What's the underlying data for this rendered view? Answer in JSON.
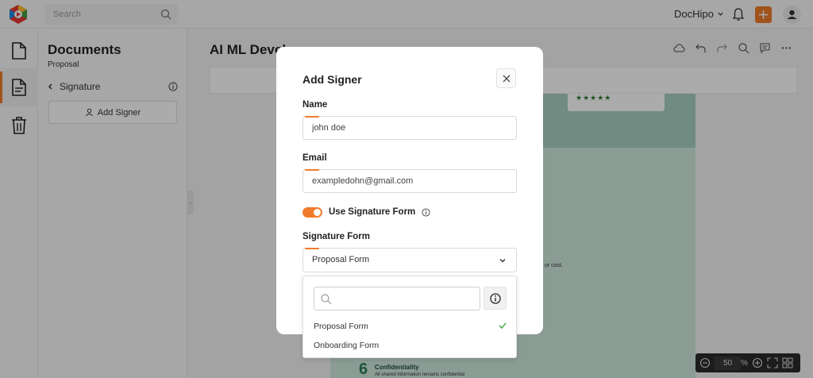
{
  "topbar": {
    "search_placeholder": "Search",
    "brand_menu_label": "DocHipo"
  },
  "panel": {
    "title": "Documents",
    "subtitle": "Proposal",
    "section_label": "Signature",
    "add_signer_label": "Add Signer"
  },
  "document": {
    "title": "AI ML Devel",
    "snippet": "or cost.",
    "section_number": "6",
    "section_title": "Confidentiality",
    "section_text": "All shared information remains confidential"
  },
  "zoom": {
    "value": "50",
    "unit": "%"
  },
  "modal": {
    "title": "Add Signer",
    "name_label": "Name",
    "name_value": "john doe",
    "email_label": "Email",
    "email_value": "exampledohn@gmail.com",
    "toggle_label": "Use Signature Form",
    "toggle_on": true,
    "form_label": "Signature Form",
    "form_selected": "Proposal Form"
  },
  "dropdown": {
    "search_value": "",
    "options": [
      {
        "label": "Proposal Form",
        "selected": true
      },
      {
        "label": "Onboarding Form",
        "selected": false
      }
    ]
  },
  "colors": {
    "accent": "#f07c2b",
    "doc_green": "#cfe9df",
    "check_green": "#4caf50"
  }
}
